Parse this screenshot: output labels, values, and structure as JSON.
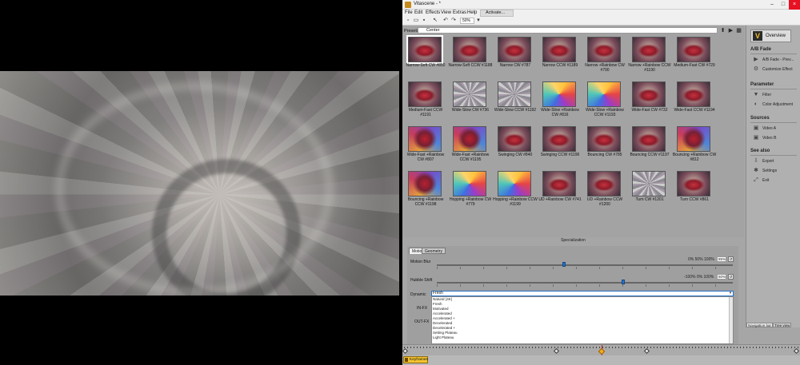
{
  "window": {
    "title": "Vitascene - *",
    "minimize": "–",
    "maximize": "□",
    "close": "×"
  },
  "menu": [
    "File",
    "Edit",
    "Effects",
    "View",
    "Extras",
    "Help"
  ],
  "activate_label": "Activate...",
  "toolbar": {
    "new_icon": "new-file-icon",
    "open_icon": "open-file-icon",
    "save_icon": "save-file-icon",
    "undo_icon": "undo-icon",
    "zoom_value": "50%"
  },
  "presets": {
    "label": "Presets",
    "current": "Center",
    "items": [
      {
        "name": "Narrow-Soft CW #850",
        "style": "red",
        "selected": true
      },
      {
        "name": "Narrow-Soft CCW #1188",
        "style": "red"
      },
      {
        "name": "Narrow CW #787",
        "style": "red"
      },
      {
        "name": "Narrow CCW #1189",
        "style": "red"
      },
      {
        "name": "Narrow +Rainbow CW #790",
        "style": "red"
      },
      {
        "name": "Narrow +Rainbow CCW #1190",
        "style": "red"
      },
      {
        "name": "Medium-Fast CW #729",
        "style": "red"
      },
      {
        "name": "Medium-Fast CCW #1191",
        "style": "red"
      },
      {
        "name": "Wide-Slow CW #736",
        "style": "swirl"
      },
      {
        "name": "Wide-Slow CCW #1192",
        "style": "swirl"
      },
      {
        "name": "Wide-Slow +Rainbow CW #816",
        "style": "rainbow"
      },
      {
        "name": "Wide-Slow +Rainbow CCW #1193",
        "style": "rainbow"
      },
      {
        "name": "Wide-Fast CW #732",
        "style": "red"
      },
      {
        "name": "Wide-Fast CCW #1194",
        "style": "red"
      },
      {
        "name": "Wide-Fast +Rainbow CW #807",
        "style": "rainbow2"
      },
      {
        "name": "Wide-Fast +Rainbow CCW #1195",
        "style": "rainbow2"
      },
      {
        "name": "Swinging CW #840",
        "style": "red"
      },
      {
        "name": "Swinging CCW #1196",
        "style": "red"
      },
      {
        "name": "Bouncing CW #785",
        "style": "red"
      },
      {
        "name": "Bouncing CCW #1197",
        "style": "red"
      },
      {
        "name": "Bouncing +Rainbow CW #812",
        "style": "rainbow2"
      },
      {
        "name": "Bouncing +Rainbow CCW #1198",
        "style": "rainbow2"
      },
      {
        "name": "Hopping +Rainbow CW #779",
        "style": "rainbow"
      },
      {
        "name": "Hopping +Rainbow CCW #1199",
        "style": "rainbow"
      },
      {
        "name": "UD +Rainbow CW #741",
        "style": "red"
      },
      {
        "name": "UD +Rainbow CCW #1200",
        "style": "red"
      },
      {
        "name": "Turn CW #1201",
        "style": "swirl"
      },
      {
        "name": "Turn CCW #861",
        "style": "red"
      }
    ]
  },
  "right_panel": {
    "overview": "Overview",
    "sections": [
      {
        "title": "A/B Fade",
        "items": [
          {
            "label": "A/B Fade - Prev...",
            "icon": "play-icon",
            "glyph": "▶"
          },
          {
            "label": "Customize Effect",
            "icon": "customize-icon",
            "glyph": "⚙"
          }
        ]
      },
      {
        "title": "Parameter",
        "items": [
          {
            "label": "Filter",
            "icon": "filter-icon",
            "glyph": "▼"
          },
          {
            "label": "Color Adjustment",
            "icon": "color-adjust-icon",
            "glyph": "◐"
          }
        ]
      },
      {
        "title": "Sources",
        "items": [
          {
            "label": "Video A",
            "icon": "video-a-icon",
            "glyph": "▣"
          },
          {
            "label": "Video B",
            "icon": "video-b-icon",
            "glyph": "▣"
          }
        ]
      },
      {
        "title": "See also",
        "items": [
          {
            "label": "Export",
            "icon": "export-icon",
            "glyph": "⇩"
          },
          {
            "label": "Settings",
            "icon": "settings-icon",
            "glyph": "✱"
          },
          {
            "label": "Exit",
            "icon": "exit-icon",
            "glyph": "⤢"
          }
        ]
      }
    ],
    "nav_tabs": [
      "Navigation bar",
      "Tree view"
    ]
  },
  "specialization": {
    "title": "Specialization",
    "tabs": [
      "Motion",
      "Geometry"
    ],
    "motion_blur": {
      "label": "Motion Blur",
      "presets": "0%   50%   100%",
      "value": "85%",
      "position": 0.43
    },
    "hubble_shift": {
      "label": "Hubble Shift",
      "presets": "-100%   0%   100%",
      "value": "50%",
      "position": 0.63
    },
    "dynamic": {
      "label": "Dynamic",
      "value": "Fresh",
      "options": [
        "Natural (4K)",
        "Fresh",
        "Motivated",
        "Accelerated",
        "Accelerated +",
        "Decelerated",
        "Decelerated +",
        "Setting Plateau",
        "Light Plateau"
      ]
    },
    "in_fx": "IN-FX",
    "out_fx": "OUT-FX",
    "reset_label": "↺"
  },
  "timeline": {
    "keyframes_label": "Keyframes"
  }
}
